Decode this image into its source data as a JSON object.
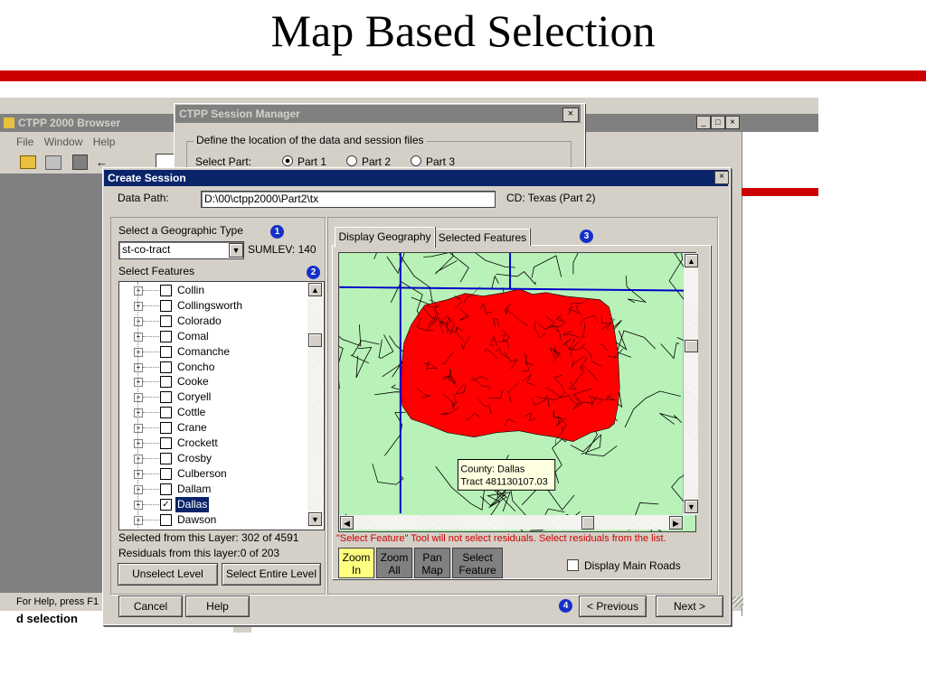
{
  "slide": {
    "title": "Map Based Selection"
  },
  "browser_window": {
    "title": "CTPP 2000 Browser",
    "menu": [
      "File",
      "Window",
      "Help"
    ],
    "status_text": "For Help, press F1",
    "bottom_text": "d selection"
  },
  "session_manager": {
    "title": "CTPP Session Manager",
    "close_label": "×",
    "group_label": "Define the location of the data and session files",
    "select_part_label": "Select Part:",
    "parts": [
      "Part 1",
      "Part 2",
      "Part 3"
    ],
    "selected_part": "Part 1"
  },
  "create_session": {
    "title": "Create Session",
    "close_label": "×",
    "data_path_label": "Data Path:",
    "data_path_value": "D:\\00\\ctpp2000\\Part2\\tx",
    "cd_label": "CD: Texas (Part 2)",
    "geo_type_label": "Select a Geographic Type",
    "geo_type_value": "st-co-tract",
    "sumlev_label": "SUMLEV: 140",
    "select_features_label": "Select Features",
    "features": [
      {
        "label": "Collin",
        "checked": false
      },
      {
        "label": "Collingsworth",
        "checked": false
      },
      {
        "label": "Colorado",
        "checked": false
      },
      {
        "label": "Comal",
        "checked": false
      },
      {
        "label": "Comanche",
        "checked": false
      },
      {
        "label": "Concho",
        "checked": false
      },
      {
        "label": "Cooke",
        "checked": false
      },
      {
        "label": "Coryell",
        "checked": false
      },
      {
        "label": "Cottle",
        "checked": false
      },
      {
        "label": "Crane",
        "checked": false
      },
      {
        "label": "Crockett",
        "checked": false
      },
      {
        "label": "Crosby",
        "checked": false
      },
      {
        "label": "Culberson",
        "checked": false
      },
      {
        "label": "Dallam",
        "checked": false
      },
      {
        "label": "Dallas",
        "checked": true
      },
      {
        "label": "Dawson",
        "checked": false
      }
    ],
    "selected_from_layer": "Selected from this Layer: 302 of 4591",
    "residuals_from_layer": "Residuals from this layer:0 of 203",
    "unselect_level_label": "Unselect Level",
    "select_entire_level_label": "Select Entire Level",
    "tabs": [
      "Display Geography",
      "Selected Features"
    ],
    "active_tab": "Display Geography",
    "tooltip_county": "County: Dallas",
    "tooltip_tract": "Tract 481130107.03",
    "warning": "\"Select Feature\" Tool will not select residuals.  Select residuals from the list.",
    "tools": [
      {
        "line1": "Zoom",
        "line2": "In",
        "active": true
      },
      {
        "line1": "Zoom",
        "line2": "All",
        "active": false
      },
      {
        "line1": "Pan",
        "line2": "Map",
        "active": false
      },
      {
        "line1": "Select",
        "line2": "Feature",
        "active": false
      }
    ],
    "display_main_roads_label": "Display Main Roads",
    "cancel_label": "Cancel",
    "help_label": "Help",
    "previous_label": "< Previous",
    "next_label": "Next >",
    "badges": [
      "1",
      "2",
      "3",
      "4"
    ]
  },
  "colors": {
    "slide_rule": "#cc0000",
    "dialog_bg": "#d4d0c8",
    "active_titlebar": "#0a246a",
    "inactive_titlebar": "#808080",
    "map_background": "#b8f2b8",
    "map_selected": "#ff0000",
    "map_county_lines": "#0000cc",
    "warning_text": "#cc0000",
    "zoom_in_active": "#ffff80",
    "tool_inactive": "#808080",
    "badge": "#1530c8"
  },
  "icons": [
    "open-folder-icon",
    "copy-icon",
    "grid-icon",
    "checkbox-icon",
    "tree-expand-icon",
    "dropdown-arrow-icon",
    "scroll-up-icon",
    "scroll-down-icon",
    "scroll-left-icon",
    "scroll-right-icon",
    "resize-grip-icon"
  ]
}
